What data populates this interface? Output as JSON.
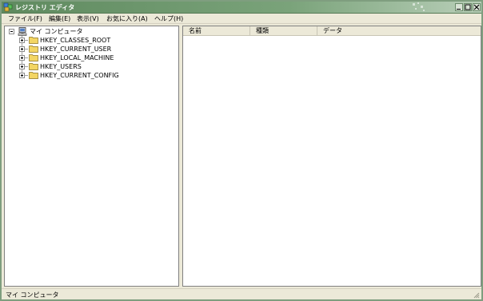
{
  "window": {
    "title": "レジストリ エディタ"
  },
  "menu": {
    "file": "ファイル(F)",
    "edit": "編集(E)",
    "view": "表示(V)",
    "favorites": "お気に入り(A)",
    "help": "ヘルプ(H)"
  },
  "tree": {
    "root": "マイ コンピュータ",
    "keys": [
      {
        "label": "HKEY_CLASSES_ROOT"
      },
      {
        "label": "HKEY_CURRENT_USER"
      },
      {
        "label": "HKEY_LOCAL_MACHINE"
      },
      {
        "label": "HKEY_USERS"
      },
      {
        "label": "HKEY_CURRENT_CONFIG"
      }
    ]
  },
  "list": {
    "columns": {
      "name": "名前",
      "type": "種類",
      "data": "データ"
    }
  },
  "status": {
    "text": "マイ コンピュータ"
  },
  "icons": {
    "app": "registry-editor-icon",
    "computer": "computer-icon",
    "folder": "folder-icon",
    "minimize": "minimize-icon",
    "maximize": "maximize-icon",
    "close": "close-icon"
  },
  "colors": {
    "titlebar": "#7aa37a",
    "folder": "#f3d563"
  }
}
